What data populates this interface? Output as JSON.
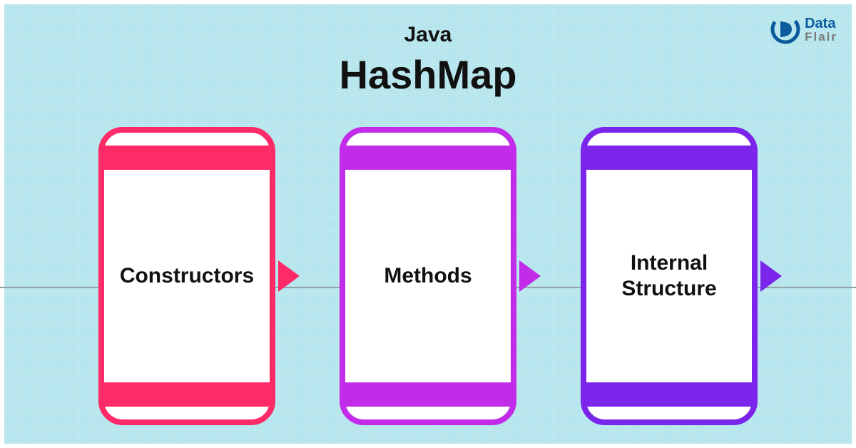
{
  "logo": {
    "line1": "Data",
    "line2": "Flair"
  },
  "title": {
    "small": "Java",
    "big": "HashMap"
  },
  "cards": [
    {
      "label": "Constructors",
      "color": "pink"
    },
    {
      "label": "Methods",
      "color": "magenta"
    },
    {
      "label": "Internal\nStructure",
      "color": "purple"
    }
  ]
}
